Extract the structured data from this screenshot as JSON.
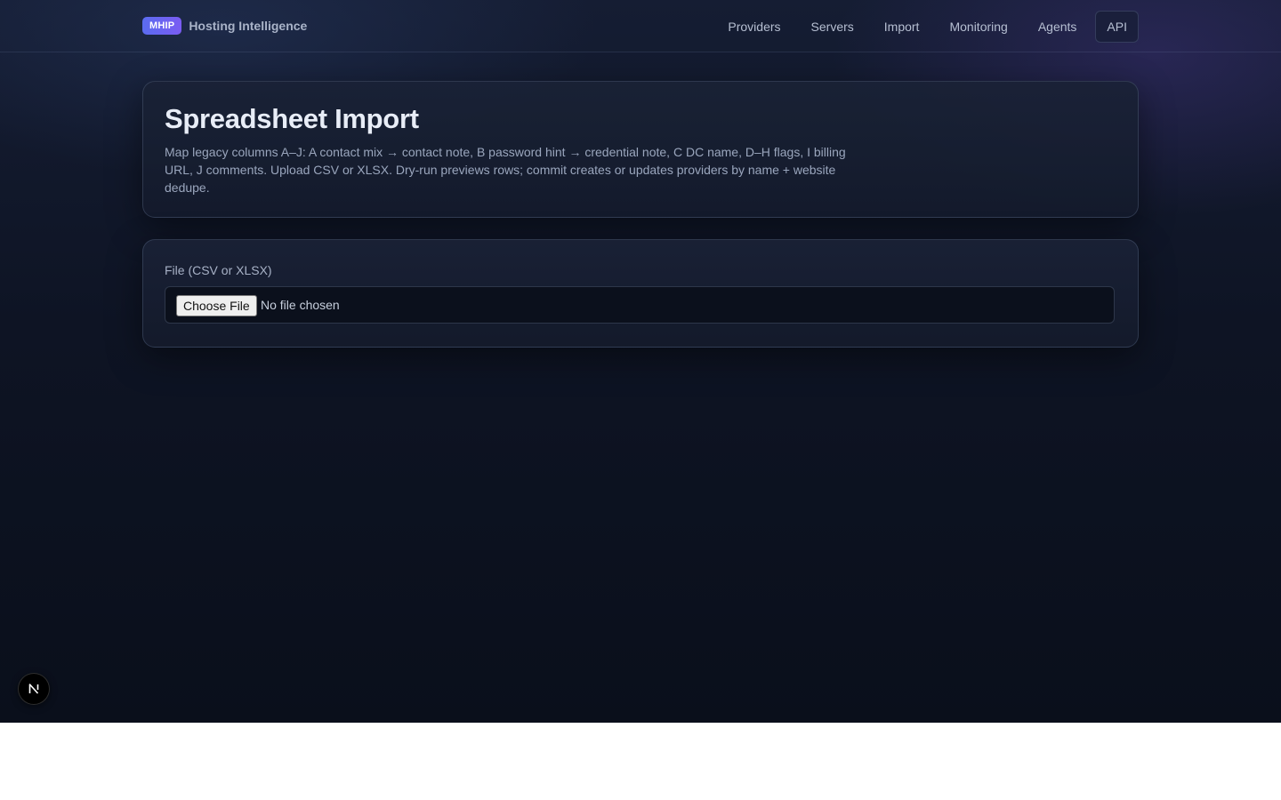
{
  "header": {
    "brand_badge": "MHIP",
    "brand_name": "Hosting Intelligence",
    "nav": [
      {
        "label": "Providers"
      },
      {
        "label": "Servers"
      },
      {
        "label": "Import"
      },
      {
        "label": "Monitoring"
      },
      {
        "label": "Agents"
      },
      {
        "label": "API"
      }
    ]
  },
  "intro": {
    "title": "Spreadsheet Import",
    "description": "Map legacy columns A–J: A contact mix → contact note, B password hint → credential note, C DC name, D–H flags, I billing URL, J comments. Upload CSV or XLSX. Dry-run previews rows; commit creates or updates providers by name + website dedupe."
  },
  "upload": {
    "label": "File (CSV or XLSX)",
    "button_label": "Choose File",
    "status": "No file chosen"
  },
  "dev_badge": {
    "icon": "nextjs-logo-icon"
  },
  "colors": {
    "accent": "#6b63f1",
    "background": "#0e1424"
  }
}
